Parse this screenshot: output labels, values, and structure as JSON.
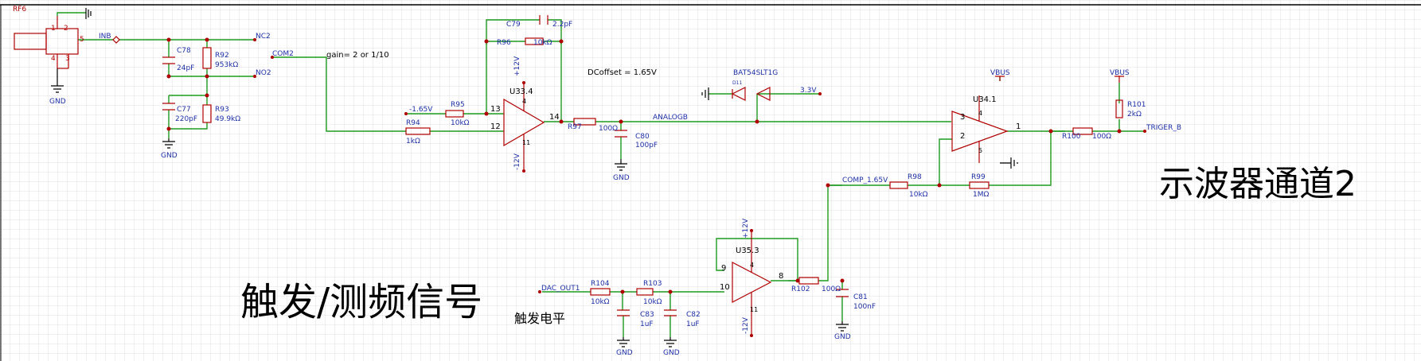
{
  "colors": {
    "wire": "#1f9a1f",
    "component": "#b00000",
    "label": "#1c2fa8",
    "grid": "#d7d7d7",
    "text": "#000000"
  },
  "section_titles": {
    "channel": "示波器通道2",
    "trigger": "触发/测频信号",
    "trigger_level": "触发电平"
  },
  "annotations": {
    "gain": "gain= 2 or 1/10",
    "dc_offset": "DCoffset = 1.65V"
  },
  "connector": {
    "ref": "RF6",
    "pins": [
      "1",
      "2",
      "3",
      "4",
      "5"
    ]
  },
  "nets": {
    "inb": "INB",
    "nc2": "NC2",
    "no2": "NO2",
    "com2": "COM2",
    "neg165": "-1.65V",
    "analogb": "ANALOGB",
    "v33": "3.3V",
    "vbus": "VBUS",
    "triger_b": "TRIGER_B",
    "comp": "COMP_1.65V",
    "dac_out1": "DAC_OUT1",
    "gnd": "GND"
  },
  "opamps": [
    {
      "ref": "U33.4",
      "plus": "+12V",
      "minus": "-12V",
      "pins": [
        "13",
        "12",
        "14",
        "4",
        "11"
      ]
    },
    {
      "ref": "U34.1",
      "pins": [
        "3",
        "2",
        "1",
        "4",
        "5"
      ]
    },
    {
      "ref": "U35.3",
      "plus": "+12V",
      "minus": "-12V",
      "pins": [
        "9",
        "10",
        "8",
        "4",
        "11"
      ]
    }
  ],
  "components": {
    "C78": {
      "ref": "C78",
      "value": "24pF"
    },
    "R92": {
      "ref": "R92",
      "value": "953kΩ"
    },
    "C77": {
      "ref": "C77",
      "value": "220pF"
    },
    "R93": {
      "ref": "R93",
      "value": "49.9kΩ"
    },
    "C79": {
      "ref": "C79",
      "value": "2.2pF"
    },
    "R96": {
      "ref": "R96",
      "value": "10kΩ"
    },
    "R95": {
      "ref": "R95",
      "value": "10kΩ"
    },
    "R94": {
      "ref": "R94",
      "value": "1kΩ"
    },
    "R97": {
      "ref": "R97",
      "value": "100Ω"
    },
    "C80": {
      "ref": "C80",
      "value": "100pF"
    },
    "D11": {
      "ref": "BAT54SLT1G",
      "sub": "D11"
    },
    "R98": {
      "ref": "R98",
      "value": "10kΩ"
    },
    "R99": {
      "ref": "R99",
      "value": "1MΩ"
    },
    "R100": {
      "ref": "R100",
      "value": "100Ω"
    },
    "R101": {
      "ref": "R101",
      "value": "2kΩ"
    },
    "R104": {
      "ref": "R104",
      "value": "10kΩ"
    },
    "R103": {
      "ref": "R103",
      "value": "10kΩ"
    },
    "C83": {
      "ref": "C83",
      "value": "1uF"
    },
    "C82": {
      "ref": "C82",
      "value": "1uF"
    },
    "R102": {
      "ref": "R102",
      "value": "100Ω"
    },
    "C81": {
      "ref": "C81",
      "value": "100nF"
    }
  }
}
